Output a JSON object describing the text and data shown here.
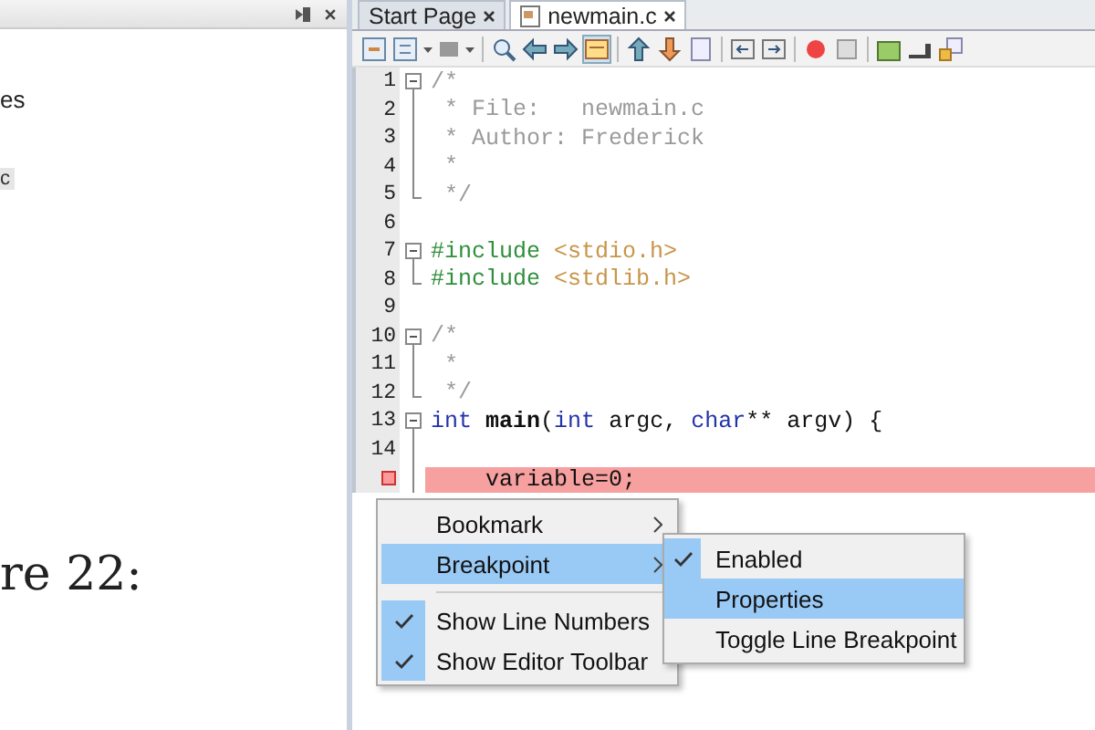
{
  "left_panel": {
    "texts": [
      {
        "kind": "plain",
        "text": "es"
      },
      {
        "kind": "key",
        "text": "c"
      },
      {
        "kind": "large",
        "text": "re 22:"
      }
    ]
  },
  "tabs": [
    {
      "label": "Start Page",
      "selected": false,
      "file_icon": false
    },
    {
      "label": "newmain.c",
      "selected": true,
      "file_icon": true
    }
  ],
  "editor": {
    "lines": [
      {
        "number": "1",
        "kind": "start",
        "tokens": [
          {
            "kind": "comment",
            "text": "/*"
          }
        ]
      },
      {
        "number": "2",
        "kind": "inner",
        "tokens": [
          {
            "kind": "comment",
            "text": " * File:   newmain.c"
          }
        ]
      },
      {
        "number": "3",
        "kind": "inner",
        "tokens": [
          {
            "kind": "comment",
            "text": " * Author: Frederick"
          }
        ]
      },
      {
        "number": "4",
        "kind": "inner",
        "tokens": [
          {
            "kind": "comment",
            "text": " *"
          }
        ]
      },
      {
        "number": "5",
        "kind": "end",
        "tokens": [
          {
            "kind": "comment",
            "text": " */"
          }
        ]
      },
      {
        "number": "6",
        "kind": "plain"
      },
      {
        "number": "7",
        "kind": "start",
        "tokens": [
          {
            "kind": "directive",
            "text": "#include"
          },
          {
            "kind": "string",
            "text": " <stdio.h>"
          }
        ]
      },
      {
        "number": "8",
        "kind": "end",
        "tokens": [
          {
            "kind": "directive",
            "text": "#include"
          },
          {
            "kind": "string",
            "text": " <stdlib.h>"
          }
        ]
      },
      {
        "number": "9",
        "kind": "plain"
      },
      {
        "number": "10",
        "kind": "start",
        "tokens": [
          {
            "kind": "comment",
            "text": "/*"
          }
        ]
      },
      {
        "number": "11",
        "kind": "inner",
        "tokens": [
          {
            "kind": "comment",
            "text": " *"
          }
        ]
      },
      {
        "number": "12",
        "kind": "end",
        "tokens": [
          {
            "kind": "comment",
            "text": " */"
          }
        ]
      },
      {
        "number": "13",
        "kind": "start",
        "tokens": [
          {
            "kind": "keyword",
            "text": "int"
          },
          {
            "kind": "function",
            "text": " main"
          },
          {
            "kind": "plain",
            "text": "("
          },
          {
            "kind": "keyword",
            "text": "int"
          },
          {
            "kind": "plain",
            "text": " argc, "
          },
          {
            "kind": "keyword",
            "text": "char"
          },
          {
            "kind": "plain",
            "text": "** argv) {"
          }
        ]
      },
      {
        "number": "14",
        "kind": "inner"
      },
      {
        "kind": "inner",
        "breakpoint": true,
        "tokens": [
          {
            "kind": "plain",
            "text": "    variable=0;"
          }
        ]
      }
    ]
  },
  "context_menu": {
    "items": [
      {
        "kind": "item",
        "label": "Bookmark",
        "checked": false,
        "selected": false,
        "submenu": true
      },
      {
        "kind": "item",
        "label": "Breakpoint",
        "checked": false,
        "selected": true,
        "submenu": true
      },
      {
        "kind": "separator"
      },
      {
        "kind": "item",
        "label": "Show Line Numbers",
        "checked": true,
        "selected": false,
        "submenu": false
      },
      {
        "kind": "item",
        "label": "Show Editor Toolbar",
        "checked": true,
        "selected": false,
        "submenu": false
      }
    ]
  },
  "submenu": {
    "items": [
      {
        "label": "Enabled",
        "checked": true,
        "selected": false
      },
      {
        "label": "Properties",
        "checked": false,
        "selected": true
      },
      {
        "label": "Toggle Line Breakpoint",
        "checked": false,
        "selected": false
      }
    ]
  }
}
